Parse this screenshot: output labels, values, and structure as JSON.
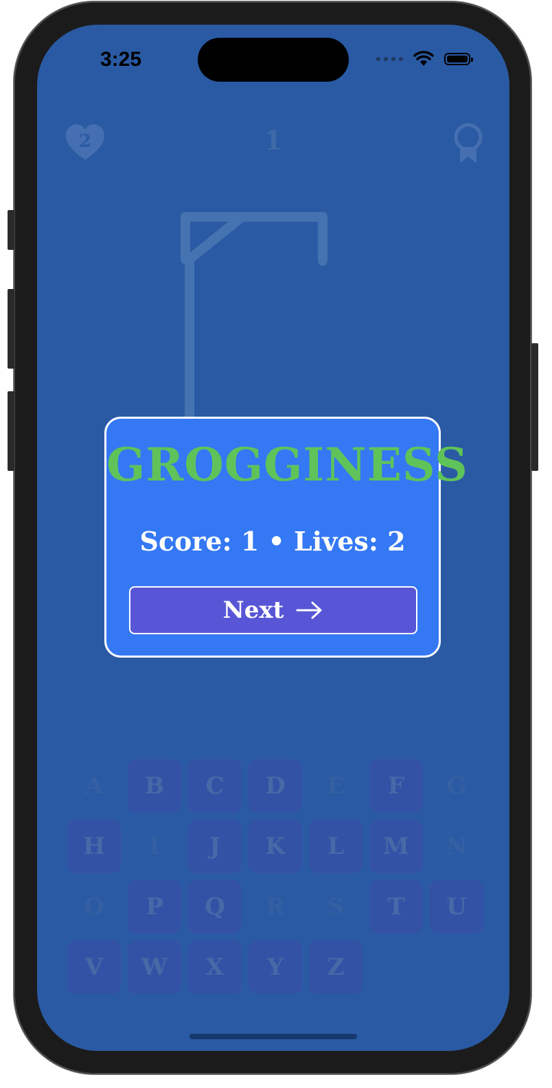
{
  "status": {
    "time": "3:25"
  },
  "hud": {
    "lives": "2",
    "round": "1"
  },
  "keyboard": {
    "rows": [
      [
        {
          "k": "A",
          "s": "dim"
        },
        {
          "k": "B",
          "s": "used"
        },
        {
          "k": "C",
          "s": "used"
        },
        {
          "k": "D",
          "s": "used"
        },
        {
          "k": "E",
          "s": "dim"
        },
        {
          "k": "F",
          "s": "used"
        },
        {
          "k": "G",
          "s": "dim"
        }
      ],
      [
        {
          "k": "H",
          "s": "used"
        },
        {
          "k": "I",
          "s": "dim"
        },
        {
          "k": "J",
          "s": "used"
        },
        {
          "k": "K",
          "s": "used"
        },
        {
          "k": "L",
          "s": "used"
        },
        {
          "k": "M",
          "s": "used"
        },
        {
          "k": "N",
          "s": "dim"
        }
      ],
      [
        {
          "k": "O",
          "s": "dim"
        },
        {
          "k": "P",
          "s": "used"
        },
        {
          "k": "Q",
          "s": "used"
        },
        {
          "k": "R",
          "s": "dim"
        },
        {
          "k": "S",
          "s": "dim"
        },
        {
          "k": "T",
          "s": "used"
        },
        {
          "k": "U",
          "s": "used"
        }
      ],
      [
        {
          "k": "V",
          "s": "used"
        },
        {
          "k": "W",
          "s": "used"
        },
        {
          "k": "X",
          "s": "used"
        },
        {
          "k": "Y",
          "s": "used"
        },
        {
          "k": "Z",
          "s": "used"
        }
      ]
    ]
  },
  "dialog": {
    "word": "GROGGINESS",
    "score_text": "Score: 1 • Lives: 2",
    "next_label": "Next"
  },
  "colors": {
    "background": "#2a5aa4",
    "dialog": "#3478f4",
    "word": "#5fc35a",
    "next_button": "#5856d6"
  }
}
